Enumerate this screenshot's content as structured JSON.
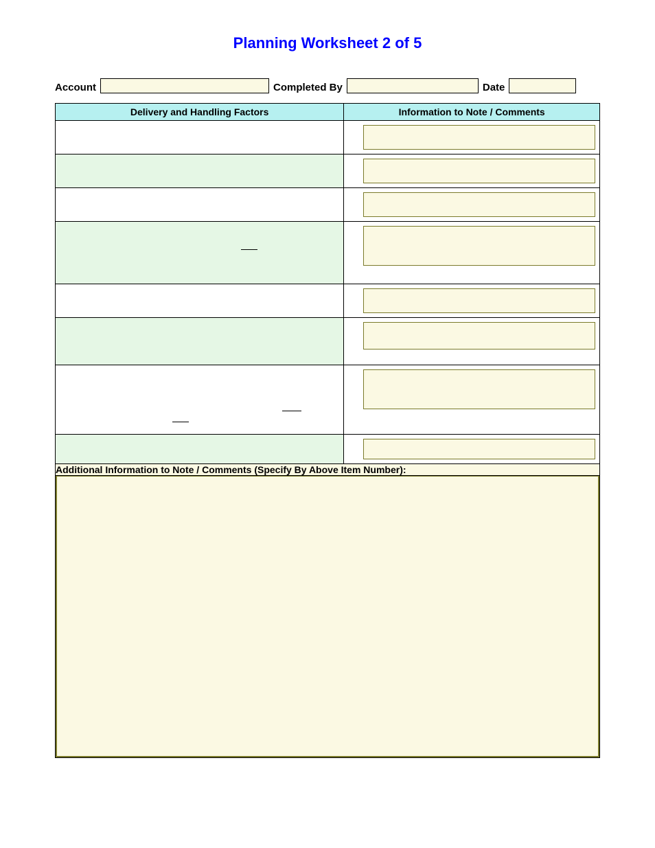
{
  "title": "Planning Worksheet 2 of 5",
  "header": {
    "account_label": "Account",
    "account_value": "",
    "completed_label": "Completed By",
    "completed_value": "",
    "date_label": "Date",
    "date_value": ""
  },
  "columns": {
    "left": "Delivery and Handling Factors",
    "right": "Information to Note / Comments"
  },
  "rows": [
    {
      "factor": "",
      "comment": ""
    },
    {
      "factor": "",
      "comment": ""
    },
    {
      "factor": "",
      "comment": ""
    },
    {
      "factor": "",
      "comment": ""
    },
    {
      "factor": "",
      "comment": ""
    },
    {
      "factor": "",
      "comment": ""
    },
    {
      "factor": "",
      "comment": ""
    },
    {
      "factor": "",
      "comment": ""
    }
  ],
  "additional_label": "Additional Information to Note / Comments (Specify By Above Item Number):",
  "additional_value": ""
}
